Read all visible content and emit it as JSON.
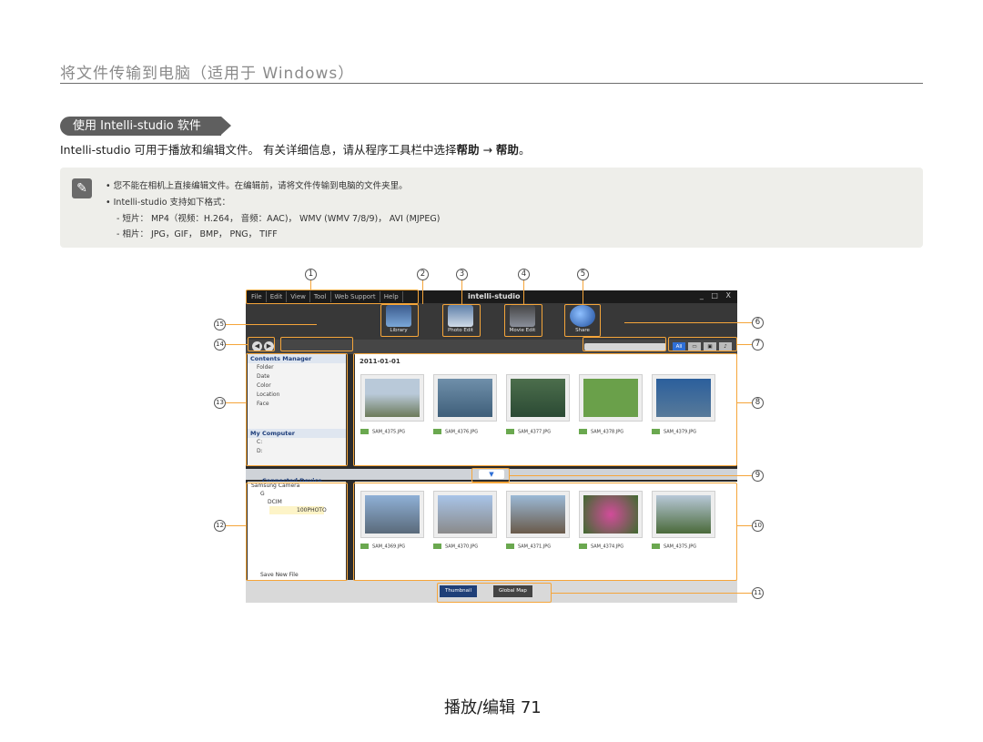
{
  "header": {
    "title": "将文件传输到电脑（适用于 Windows）"
  },
  "section": {
    "pill": "使用 Intelli-studio 软件"
  },
  "intro": {
    "pre": "Intelli-studio 可用于播放和编辑文件。 有关详细信息，请从程序工具栏中选择",
    "b1": "帮助",
    "arrow": " → ",
    "b2": "帮助",
    "post": "。"
  },
  "note": {
    "icon_name": "pencil-note-icon",
    "line1": "•  您不能在相机上直接编辑文件。在编辑前，请将文件传输到电脑的文件夹里。",
    "line2": "•  Intelli-studio 支持如下格式：",
    "line3": "- 短片： MP4（视频：H.264， 音频：AAC)， WMV (WMV 7/8/9)， AVI (MJPEG)",
    "line4": "- 相片： JPG，GIF， BMP， PNG， TIFF"
  },
  "app": {
    "menu": [
      "File",
      "Edit",
      "View",
      "Tool",
      "Web Support",
      "Help"
    ],
    "logo": "intelli-studio",
    "window_controls": "_ □ X",
    "modes": [
      "Library",
      "Photo Edit",
      "Movie Edit",
      "Share"
    ],
    "view_buttons": [
      "All",
      "▭",
      "▣",
      "♪"
    ],
    "contents_manager": {
      "title": "Contents Manager",
      "items": [
        "Folder",
        "Date",
        "Color",
        "Location",
        "Face"
      ]
    },
    "my_computer": {
      "title": "My Computer",
      "drives": [
        "C:",
        "D:"
      ]
    },
    "date_header": "2011-01-01",
    "top_thumbs": [
      "SAM_4375.JPG",
      "SAM_4376.JPG",
      "SAM_4377.JPG",
      "SAM_4378.JPG",
      "SAM_4379.JPG"
    ],
    "connected_device": {
      "title": "Connected Device",
      "tree": [
        "Samsung Camera",
        "G",
        "DCIM",
        "100PHOTO"
      ],
      "save_new": "Save New File"
    },
    "bottom_thumbs": [
      "SAM_4369.JPG",
      "SAM_4370.JPG",
      "SAM_4371.JPG",
      "SAM_4374.JPG",
      "SAM_4375.JPG"
    ],
    "bottom_tabs": [
      "Thumbnail",
      "Global Map"
    ]
  },
  "callouts": [
    "1",
    "2",
    "3",
    "4",
    "5",
    "6",
    "7",
    "8",
    "9",
    "10",
    "11",
    "12",
    "13",
    "14",
    "15"
  ],
  "colors": {
    "highlight": "#f5a53a",
    "pill": "#5f5f5f"
  },
  "footer": {
    "label": "播放/编辑",
    "page": "71"
  }
}
